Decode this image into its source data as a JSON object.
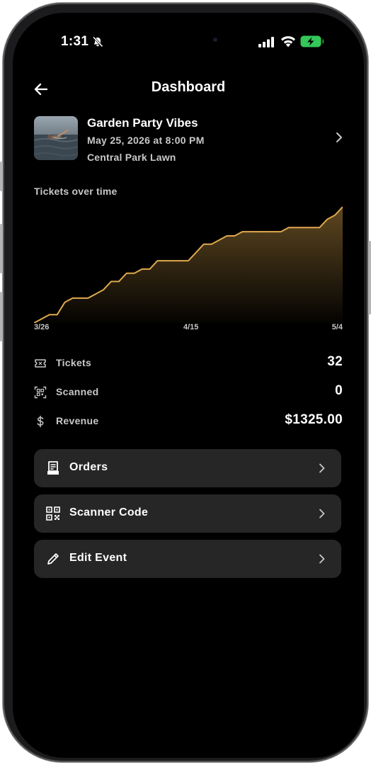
{
  "status": {
    "time": "1:31"
  },
  "nav": {
    "title": "Dashboard"
  },
  "event": {
    "title": "Garden Party Vibes",
    "date": "May 25, 2026 at 8:00 PM",
    "location": "Central Park Lawn"
  },
  "chart": {
    "title": "Tickets over time",
    "accent": "#e0a94e"
  },
  "chart_data": {
    "type": "area",
    "title": "Tickets over time",
    "x_ticks": [
      "3/26",
      "4/15",
      "5/4"
    ],
    "x": [
      "3/26",
      "3/27",
      "3/28",
      "3/29",
      "3/30",
      "3/31",
      "4/1",
      "4/2",
      "4/3",
      "4/4",
      "4/5",
      "4/6",
      "4/7",
      "4/8",
      "4/9",
      "4/10",
      "4/11",
      "4/12",
      "4/13",
      "4/14",
      "4/15",
      "4/16",
      "4/17",
      "4/18",
      "4/19",
      "4/20",
      "4/21",
      "4/22",
      "4/23",
      "4/24",
      "4/25",
      "4/26",
      "4/27",
      "4/28",
      "4/29",
      "4/30",
      "5/1",
      "5/2",
      "5/3",
      "5/4"
    ],
    "values": [
      0,
      1,
      2,
      2,
      5,
      6,
      6,
      6,
      7,
      8,
      10,
      10,
      12,
      12,
      13,
      13,
      15,
      15,
      15,
      15,
      15,
      17,
      19,
      19,
      20,
      21,
      21,
      22,
      22,
      22,
      22,
      22,
      22,
      23,
      23,
      23,
      23,
      23,
      25,
      26,
      28
    ],
    "series": [
      {
        "values": [
          0,
          1,
          2,
          2,
          5,
          6,
          6,
          6,
          7,
          8,
          10,
          10,
          12,
          12,
          13,
          13,
          15,
          15,
          15,
          15,
          15,
          17,
          19,
          19,
          20,
          21,
          21,
          22,
          22,
          22,
          22,
          22,
          22,
          23,
          23,
          23,
          23,
          23,
          25,
          26,
          28
        ]
      }
    ],
    "ylim": [
      0,
      28
    ],
    "grid": false
  },
  "stats": {
    "tickets_label": "Tickets",
    "tickets_value": "32",
    "scanned_label": "Scanned",
    "scanned_value": "0",
    "revenue_label": "Revenue",
    "revenue_value": "$1325.00"
  },
  "menu": {
    "orders": "Orders",
    "scanner_code": "Scanner Code",
    "edit_event": "Edit Event"
  },
  "icons": [
    "bell-slash-icon",
    "signal-icon",
    "wifi-icon",
    "battery-charging-icon",
    "back-arrow-icon",
    "chevron-right-icon",
    "ticket-icon",
    "scan-icon",
    "dollar-icon",
    "receipt-icon",
    "qr-code-icon",
    "pencil-icon"
  ]
}
